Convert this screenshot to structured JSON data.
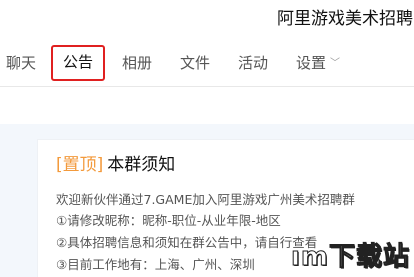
{
  "header": {
    "title": "阿里游戏美术招聘"
  },
  "tabs": [
    {
      "label": "聊天"
    },
    {
      "label": "公告"
    },
    {
      "label": "相册"
    },
    {
      "label": "文件"
    },
    {
      "label": "活动"
    },
    {
      "label": "设置"
    }
  ],
  "notice": {
    "pin_label": "[置顶]",
    "title": "本群须知",
    "lines": [
      "欢迎新伙伴通过7.GAME加入阿里游戏广州美术招聘群",
      "①请修改昵称：昵称-职位-从业年限-地区",
      "②具体招聘信息和须知在群公告中，请自行查看",
      "③目前工作地有：上海、广州、深圳"
    ]
  },
  "watermark": {
    "text": "ım下载站"
  },
  "colors": {
    "active_tab_border": "#e02020",
    "pin": "#f39a3c",
    "content_bg": "#f3f7fc"
  }
}
